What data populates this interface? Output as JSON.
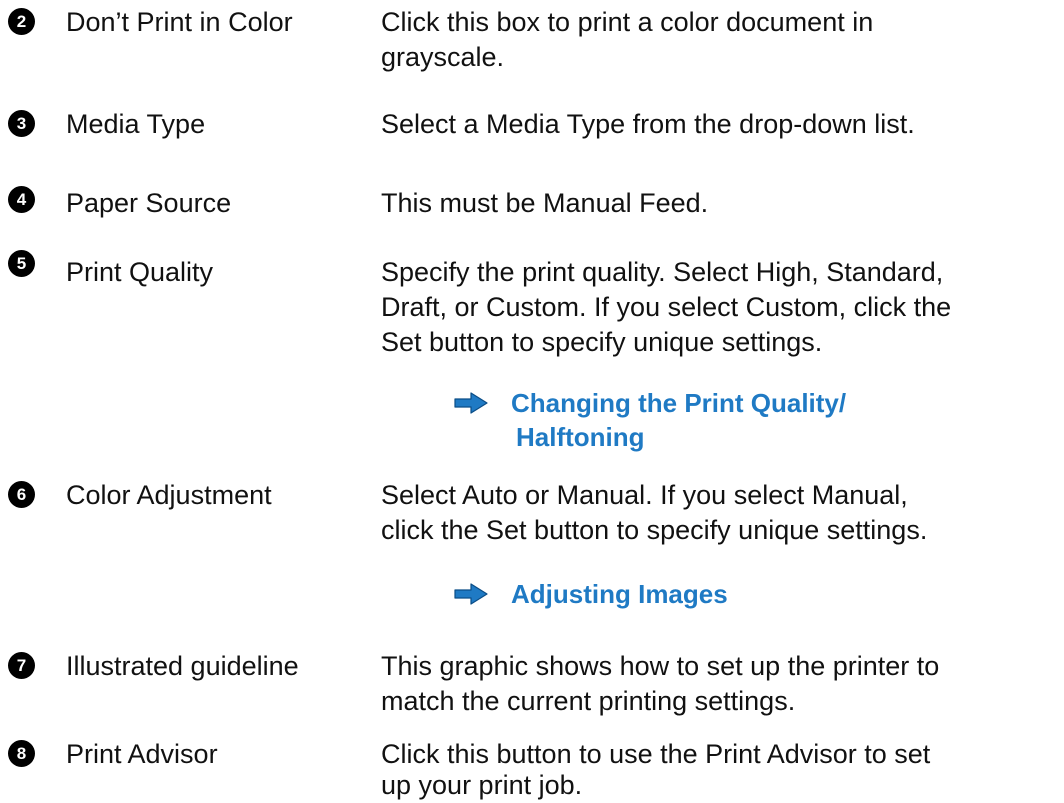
{
  "items": [
    {
      "number": "2",
      "term": "Don’t Print in Color",
      "description_lines": [
        "Click this box to print a color document in",
        "grayscale."
      ]
    },
    {
      "number": "3",
      "term": "Media Type",
      "description_lines": [
        "Select a Media Type from the drop-down list."
      ]
    },
    {
      "number": "4",
      "term": "Paper Source",
      "description_lines": [
        "This must be Manual Feed."
      ]
    },
    {
      "number": "5",
      "term": "Print Quality",
      "description_lines": [
        "Specify the print quality. Select High, Standard,",
        "Draft, or Custom. If you select Custom, click the",
        "Set button to specify unique settings."
      ],
      "link_lines": [
        "Changing the Print Quality/",
        "Halftoning"
      ]
    },
    {
      "number": "6",
      "term": "Color Adjustment",
      "description_lines": [
        "Select Auto or Manual. If you select Manual,",
        "click the Set button to specify unique settings."
      ],
      "link_lines": [
        "Adjusting Images"
      ]
    },
    {
      "number": "7",
      "term": "Illustrated guideline",
      "description_lines": [
        "This graphic shows how to set up the printer to",
        "match the current printing settings."
      ]
    },
    {
      "number": "8",
      "term": "Print Advisor",
      "description_lines": [
        "Click this button to use the Print Advisor to set",
        "up your print job."
      ]
    }
  ],
  "colors": {
    "link": "#1f7ac4",
    "badge": "#000000",
    "text": "#111111"
  },
  "icons": {
    "link_arrow": "right-arrow-icon",
    "badge": "numbered-circle-icon"
  }
}
